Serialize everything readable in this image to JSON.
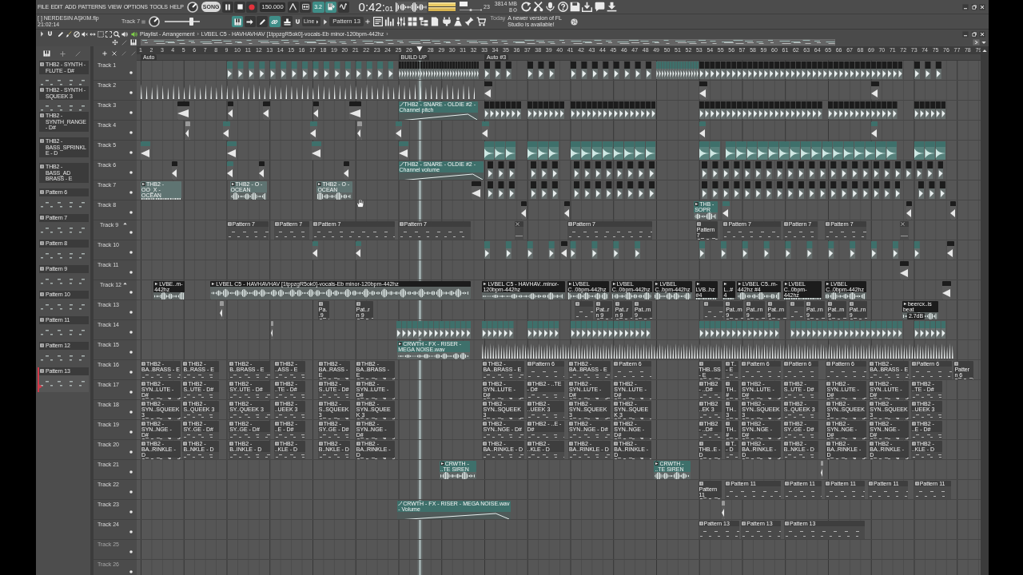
{
  "menu": [
    "FILE",
    "EDIT",
    "ADD",
    "PATTERNS",
    "VIEW",
    "OPTIONS",
    "TOOLS",
    "HELP"
  ],
  "transport": {
    "mode": "SONG",
    "playing": true,
    "tempo": "150.000",
    "toggles": [
      {
        "on": false
      },
      {
        "on": false
      },
      {
        "label": "3.2",
        "on": true
      },
      {
        "on": true
      },
      {
        "on": false
      }
    ],
    "time": "0:42:",
    "time_fraction": "01"
  },
  "meters": {
    "cpu": "23",
    "memory": "3814 MB",
    "polyphony": "8"
  },
  "hint": {
    "title": "[ ] NERDESIN AŞKIM.flp",
    "detail": "21:02:14"
  },
  "toolbar": {
    "focus": "Track 7",
    "master_slider": {
      "level": 0.75
    },
    "toggles": [
      {
        "on": true
      },
      {
        "on": false
      },
      {
        "on": false
      },
      {
        "on": true
      },
      {
        "on": false
      }
    ],
    "snap": "Line",
    "pattern": "Pattern 13"
  },
  "news": {
    "label": "Today",
    "text": "A newer version of FL Studio is available!"
  },
  "playlist": {
    "breadcrumb": [
      "Playlist - Arrangement",
      "LVBEL C5 - HAVHAVHAV [1tppzgR5ok0]-vocals-Eb minor-120bpm-442hz"
    ],
    "separator": "›",
    "ruler": [
      "1",
      "2",
      "3",
      "4",
      "5",
      "6",
      "7",
      "8",
      "9",
      "10",
      "11",
      "12",
      "13",
      "14",
      "15",
      "16",
      "17",
      "18",
      "19",
      "20",
      "21",
      "22",
      "23",
      "24",
      "25",
      "26",
      "28",
      "29",
      "30",
      "31",
      "32",
      "33",
      "34",
      "35",
      "36",
      "37",
      "38",
      "39",
      "40",
      "41",
      "42",
      "43",
      "44",
      "45",
      "46",
      "47",
      "48",
      "49",
      "50",
      "51",
      "52",
      "53",
      "54",
      "55",
      "56",
      "57",
      "58",
      "59",
      "60",
      "61",
      "62",
      "63",
      "64",
      "65",
      "66",
      "67",
      "68",
      "69",
      "70",
      "71",
      "72",
      "73",
      "74",
      "75",
      "76",
      "77",
      "78",
      "79"
    ],
    "markers": [
      "Auto",
      "BUILD UP",
      "Auto #3"
    ],
    "picker": [
      {
        "name": "THB2 - SYNTH - FLUTE - D#",
        "selected": false
      },
      {
        "name": "THB2 - SYNTH - SQUEEK 3",
        "selected": false
      },
      {
        "name": "THB2 - SYNTH_RANGE - D#",
        "selected": false
      },
      {
        "name": "THB2 - BASS_SPRINKLE - D",
        "selected": false
      },
      {
        "name": "THB2 - BASS_AD BRASS - E",
        "selected": false
      },
      {
        "name": "Pattern 6",
        "selected": false
      },
      {
        "name": "Pattern 7",
        "selected": false
      },
      {
        "name": "Pattern 8",
        "selected": false
      },
      {
        "name": "Pattern 9",
        "selected": false
      },
      {
        "name": "Pattern 10",
        "selected": false
      },
      {
        "name": "Pattern 11",
        "selected": false
      },
      {
        "name": "Pattern 12",
        "selected": false
      },
      {
        "name": "Pattern 13",
        "selected": true
      }
    ],
    "tracks": [
      {
        "name": "Track 1",
        "kind": "plain",
        "dimmed": false,
        "clips": [
          {
            "kind": "hits",
            "color": "#3e706b"
          },
          {
            "kind": "hits",
            "color": "#1c1c1c"
          },
          {
            "kind": "hits",
            "color": "#1c1c1c"
          },
          {
            "kind": "hits",
            "color": "#1c1c1c"
          },
          {
            "kind": "hits",
            "color": "#1c1c1c"
          },
          {
            "kind": "hits",
            "color": "#3e706b"
          },
          {
            "kind": "hits",
            "color": "#1c1c1c"
          },
          {
            "kind": "hits",
            "color": "#1c1c1c"
          }
        ]
      },
      {
        "name": "Track 2",
        "kind": "plain",
        "dimmed": false,
        "clips": [
          {
            "kind": "spikes"
          },
          {
            "kind": "clip",
            "color": "#1c1c1c"
          },
          {
            "kind": "clip",
            "color": "#1c1c1c"
          },
          {
            "kind": "clip",
            "color": "#1c1c1c"
          }
        ]
      },
      {
        "name": "Track 3",
        "kind": "plain",
        "dimmed": false,
        "clips": [
          {
            "kind": "clip",
            "color": "#1c1c1c"
          },
          {
            "kind": "clip",
            "color": "#1c1c1c"
          },
          {
            "kind": "clip",
            "color": "#1c1c1c"
          },
          {
            "kind": "clip",
            "color": "#1c1c1c"
          },
          {
            "kind": "clip",
            "color": "#1c1c1c"
          },
          {
            "kind": "automation",
            "label": "THB2 - SNARE - OLDIE #2 - Channel pitch",
            "color": "#3e706b"
          },
          {
            "kind": "hits",
            "color": "#1c1c1c"
          },
          {
            "kind": "hits",
            "color": "#1c1c1c"
          },
          {
            "kind": "hits",
            "color": "#1c1c1c"
          },
          {
            "kind": "hits",
            "color": "#1c1c1c"
          },
          {
            "kind": "hits",
            "color": "#1c1c1c"
          },
          {
            "kind": "hits",
            "color": "#1c1c1c"
          }
        ]
      },
      {
        "name": "Track 4",
        "kind": "plain",
        "dimmed": false,
        "clips": [
          {
            "kind": "clip",
            "color": "#9a9a9a"
          },
          {
            "kind": "clip",
            "color": "#3e706b"
          },
          {
            "kind": "clip",
            "color": "#3e706b"
          },
          {
            "kind": "clip",
            "color": "#9a9a9a"
          },
          {
            "kind": "clip",
            "color": "#3e706b"
          },
          {
            "kind": "clip",
            "color": "#3e706b"
          },
          {
            "kind": "clip",
            "color": "#3e706b"
          },
          {
            "kind": "clip",
            "color": "#3e706b"
          }
        ]
      },
      {
        "name": "Track 5",
        "kind": "plain",
        "dimmed": false,
        "clips": [
          {
            "kind": "clip",
            "color": "#3e706b"
          },
          {
            "kind": "clip",
            "color": "#3e706b"
          },
          {
            "kind": "clip",
            "color": "#3e706b"
          },
          {
            "kind": "clip",
            "color": "#3e706b"
          },
          {
            "kind": "blocks",
            "color": "#3e706b"
          },
          {
            "kind": "blocks",
            "color": "#3e706b"
          },
          {
            "kind": "blocks",
            "color": "#3e706b"
          },
          {
            "kind": "blocks",
            "color": "#3e706b"
          },
          {
            "kind": "blocks",
            "color": "#3e706b"
          },
          {
            "kind": "blocks",
            "color": "#3e706b"
          }
        ]
      },
      {
        "name": "Track 6",
        "kind": "plain",
        "dimmed": false,
        "clips": [
          {
            "kind": "clip",
            "color": "#1c1c1c"
          },
          {
            "kind": "clip",
            "color": "#3e706b"
          },
          {
            "kind": "clip",
            "color": "#1c1c1c"
          },
          {
            "kind": "clip",
            "color": "#1c1c1c"
          },
          {
            "kind": "automation",
            "label": "THB2 - SNARE - OLDIE #2 - Channel volume",
            "color": "#3e706b"
          },
          {
            "kind": "hits",
            "color": "#1c1c1c"
          },
          {
            "kind": "hits",
            "color": "#1c1c1c"
          },
          {
            "kind": "hits",
            "color": "#1c1c1c"
          },
          {
            "kind": "hits",
            "color": "#1c1c1c"
          }
        ]
      },
      {
        "name": "Track 7",
        "kind": "plain",
        "dimmed": false,
        "clips": [
          {
            "kind": "audio",
            "label": "THB2 - OO_X - OCEAN",
            "color": "#5f7472"
          },
          {
            "kind": "audio",
            "label": "THB2 - O - OCEAN",
            "color": "#5f7472"
          },
          {
            "kind": "audio",
            "label": "THB2 - O - OCEAN",
            "color": "#5f7472"
          },
          {
            "kind": "clip",
            "color": "#1c1c1c"
          },
          {
            "kind": "hits",
            "color": "#1c1c1c"
          },
          {
            "kind": "hits",
            "color": "#1c1c1c"
          },
          {
            "kind": "hits",
            "color": "#1c1c1c"
          },
          {
            "kind": "hits",
            "color": "#1c1c1c"
          },
          {
            "kind": "hits",
            "color": "#1c1c1c"
          }
        ]
      },
      {
        "name": "Track 8",
        "kind": "plain",
        "dimmed": false,
        "clips": [
          {
            "kind": "clip",
            "color": "#1c1c1c"
          },
          {
            "kind": "clip",
            "color": "#1c1c1c"
          },
          {
            "kind": "audio",
            "label": "THB - SOPR",
            "color": "#3e706b"
          },
          {
            "kind": "clip",
            "color": "#3e706b"
          },
          {
            "kind": "clip",
            "color": "#1c1c1c"
          },
          {
            "kind": "clip",
            "color": "#1c1c1c"
          }
        ]
      },
      {
        "name": "Track 9",
        "kind": "grouped",
        "dimmed": false,
        "clips": [
          {
            "kind": "pattern",
            "label": "Pattern 7"
          },
          {
            "kind": "pattern",
            "label": "Pattern 7"
          },
          {
            "kind": "pattern",
            "label": "Pattern 7"
          },
          {
            "kind": "pattern",
            "label": "Pattern 7"
          },
          {
            "kind": "empty"
          },
          {
            "kind": "pattern",
            "label": "Pattern 7"
          },
          {
            "kind": "pattern",
            "label": "Pattern 7"
          },
          {
            "kind": "pattern",
            "label": "Pattern 7"
          },
          {
            "kind": "pattern",
            "label": "Pattern 7"
          },
          {
            "kind": "pattern",
            "label": "Pattern 7"
          },
          {
            "kind": "empty"
          }
        ]
      },
      {
        "name": "Track 10",
        "kind": "plain",
        "dimmed": false,
        "clips": [
          {
            "kind": "clip",
            "color": "#3e706b"
          },
          {
            "kind": "clip",
            "color": "#3e706b"
          },
          {
            "kind": "hits",
            "color": "#3e706b"
          },
          {
            "kind": "clip",
            "color": "#1c1c1c"
          },
          {
            "kind": "hits",
            "color": "#3e706b"
          },
          {
            "kind": "clip",
            "color": "#1c1c1c"
          }
        ]
      },
      {
        "name": "Track 11",
        "kind": "plain",
        "dimmed": false,
        "clips": [
          {
            "kind": "clip",
            "color": "#1c1c1c"
          }
        ]
      },
      {
        "name": "Track 12",
        "kind": "grouped",
        "dimmed": false,
        "clips": [
          {
            "kind": "audio",
            "label": "LVBE..m-442hz",
            "color": "#1c1c1c"
          },
          {
            "kind": "audio",
            "label": "LVBEL C5 - HAVHAVHAV [1tppzgR5ok0]-vocals-Eb minor-120bpm-442hz",
            "color": "#1c1c1c"
          },
          {
            "kind": "audio",
            "label": "LVBEL C5 - HAVHAV..minor-120bpm-442hz",
            "color": "#1c1c1c"
          },
          {
            "kind": "audio",
            "label": "LVBEL C..0bpm-442hz",
            "color": "#1c1c1c"
          },
          {
            "kind": "audio",
            "label": "LVBEL C..0bpm-442hz",
            "color": "#1c1c1c"
          },
          {
            "kind": "audio",
            "label": "LVBEL C..bpm-442hz",
            "color": "#1c1c1c"
          },
          {
            "kind": "audio",
            "label": "LVB..hz #4",
            "color": "#1c1c1c"
          },
          {
            "kind": "audio",
            "label": "L..#4",
            "color": "#1c1c1c"
          },
          {
            "kind": "audio",
            "label": "LVBEL C5..m-442hz #4",
            "color": "#1c1c1c"
          },
          {
            "kind": "audio",
            "label": "LVBEL C..0bpm-442hz",
            "color": "#1c1c1c"
          },
          {
            "kind": "audio",
            "label": "LVBEL C..0bpm-442hz",
            "color": "#1c1c1c"
          },
          {
            "kind": "clip",
            "color": "#1c1c1c"
          }
        ]
      },
      {
        "name": "Track 13",
        "kind": "plain",
        "dimmed": false,
        "clips": [
          {
            "kind": "clip",
            "color": "#9a9a9a"
          },
          {
            "kind": "pattern",
            "label": "Pa..9"
          },
          {
            "kind": "pattern",
            "label": "Pat..rn 9"
          },
          {
            "kind": "pattern"
          },
          {
            "kind": "pattern",
            "label": "Pat..rn 9"
          },
          {
            "kind": "pattern",
            "label": "Pat..rn 9"
          },
          {
            "kind": "pattern",
            "label": "Pat..rn 9"
          },
          {
            "kind": "pattern"
          },
          {
            "kind": "pattern",
            "label": "Pat..rn 9"
          },
          {
            "kind": "pattern",
            "label": "Pat..rn 9"
          },
          {
            "kind": "pattern",
            "label": "Pat..rn 9"
          },
          {
            "kind": "pattern"
          },
          {
            "kind": "pattern",
            "label": "Pat..rn 9"
          },
          {
            "kind": "pattern",
            "label": "Pat..rn 9"
          },
          {
            "kind": "pattern",
            "label": "Pat..rn 9"
          },
          {
            "kind": "audio",
            "label": "beercx..is beat",
            "color": "#1c1c1c",
            "tooltip": "2.7dB"
          }
        ]
      },
      {
        "name": "Track 14",
        "kind": "plain",
        "dimmed": false,
        "clips": [
          {
            "kind": "clip",
            "color": "#9a9a9a"
          },
          {
            "kind": "hits",
            "color": "#3e706b"
          },
          {
            "kind": "hits",
            "color": "#3e706b"
          },
          {
            "kind": "hits",
            "color": "#3e706b"
          },
          {
            "kind": "hits",
            "color": "#3e706b"
          },
          {
            "kind": "hits",
            "color": "#3e706b"
          },
          {
            "kind": "hits",
            "color": "#3e706b"
          },
          {
            "kind": "hits",
            "color": "#3e706b"
          }
        ]
      },
      {
        "name": "Track 15",
        "kind": "plain",
        "dimmed": false,
        "clips": [
          {
            "kind": "audio",
            "label": "CRWTH - FX - RISER - MEGA NOISE.wav",
            "color": "#3e706b"
          },
          {
            "kind": "spikes"
          }
        ]
      },
      {
        "name": "Track 16",
        "kind": "plain",
        "dimmed": false,
        "clips": [
          {
            "kind": "pattern",
            "label": "THB2 - BA..BRASS - E"
          },
          {
            "kind": "pattern",
            "label": "THB2 - B..RASS - E"
          },
          {
            "kind": "pattern",
            "label": "THB2 - B..BRASS - E"
          },
          {
            "kind": "pattern",
            "label": "THB2 - ..ASS - E"
          },
          {
            "kind": "pattern",
            "label": "THB2 - BA..RASS - E"
          },
          {
            "kind": "pattern",
            "label": "THB2 - BA..BRASS - E"
          },
          {
            "kind": "pattern",
            "label": "THB2 - BA..BRASS - E"
          },
          {
            "kind": "pattern",
            "label": "Pattern 6"
          },
          {
            "kind": "pattern",
            "label": "THB2 - BA..BRASS - E"
          },
          {
            "kind": "pattern",
            "label": "Pattern 6"
          },
          {
            "kind": "pattern",
            "label": "THB..SS - E"
          },
          {
            "kind": "pattern",
            "label": "T.. - E"
          },
          {
            "kind": "pattern",
            "label": "Pattern 6"
          },
          {
            "kind": "pattern",
            "label": "Pattern 6"
          },
          {
            "kind": "pattern",
            "label": "Pattern 6"
          },
          {
            "kind": "pattern",
            "label": "THB2 - BA..BRASS - E"
          },
          {
            "kind": "pattern",
            "label": "Pattern 6"
          },
          {
            "kind": "pattern",
            "label": "Pattern 6"
          }
        ]
      },
      {
        "name": "Track 17",
        "kind": "plain",
        "dimmed": false,
        "clips": [
          {
            "kind": "pattern",
            "label": "THB2 - SYN..LUTE - D#"
          },
          {
            "kind": "pattern",
            "label": "THB2 - S..UTE - D#"
          },
          {
            "kind": "pattern",
            "label": "THB2 - SY..UTE - D#"
          },
          {
            "kind": "pattern",
            "label": "THB2 - ..TE - D#"
          },
          {
            "kind": "pattern",
            "label": "THB2 - S..UTE - D#"
          },
          {
            "kind": "pattern",
            "label": "THB2 - SYN..LUTE - D#"
          },
          {
            "kind": "pattern",
            "label": "THB2 - SYN..LUTE - D#"
          },
          {
            "kind": "pattern",
            "label": "THB2 - ..TE - D#"
          },
          {
            "kind": "pattern",
            "label": "THB2 - SYN..LUTE - D#"
          },
          {
            "kind": "pattern",
            "label": "THB2 - SYN..LUTE - D#"
          },
          {
            "kind": "pattern",
            "label": "THB2 - ..D#"
          },
          {
            "kind": "pattern",
            "label": "TH..#"
          },
          {
            "kind": "pattern",
            "label": "THB2 - SYN..LUTE - D#"
          },
          {
            "kind": "pattern",
            "label": "THB2 - S..UTE - D#"
          },
          {
            "kind": "pattern",
            "label": "THB2 - SYN..LUTE - D#"
          },
          {
            "kind": "pattern",
            "label": "THB2 - SYN..LUTE - D#"
          },
          {
            "kind": "pattern",
            "label": "THB2 - ..TE - D#"
          }
        ]
      },
      {
        "name": "Track 18",
        "kind": "plain",
        "dimmed": false,
        "clips": [
          {
            "kind": "pattern",
            "label": "THB2 - SYN..SQUEEK 3"
          },
          {
            "kind": "pattern",
            "label": "THB2 - S..QUEEK 3"
          },
          {
            "kind": "pattern",
            "label": "THB2 - SY..QUEEK 3"
          },
          {
            "kind": "pattern",
            "label": "THB2 - ..UEEK 3"
          },
          {
            "kind": "pattern",
            "label": "THB2 - S..SQUEEK 3"
          },
          {
            "kind": "pattern",
            "label": "THB2 - SYN..SQUEEK 3"
          },
          {
            "kind": "pattern",
            "label": "THB2 - SYN..SQUEEK 3"
          },
          {
            "kind": "pattern",
            "label": "THB2 - ..UEEK 3"
          },
          {
            "kind": "pattern",
            "label": "THB2 - SYN..SQUEEK 3"
          },
          {
            "kind": "pattern",
            "label": "THB2 - SYN..SQUEEK 3"
          },
          {
            "kind": "pattern",
            "label": "THB2 ..EK 3"
          },
          {
            "kind": "pattern",
            "label": "TH..3"
          },
          {
            "kind": "pattern",
            "label": "THB2 - SYN..SQUEEK 3"
          },
          {
            "kind": "pattern",
            "label": "THB2 - S..QUEEK 3"
          },
          {
            "kind": "pattern",
            "label": "THB2 - SYN..SQUEEK 3"
          },
          {
            "kind": "pattern",
            "label": "THB2 - SYN..SQUEEK 3"
          },
          {
            "kind": "pattern",
            "label": "THB2 - ..UEEK 3"
          }
        ]
      },
      {
        "name": "Track 19",
        "kind": "plain",
        "dimmed": false,
        "clips": [
          {
            "kind": "pattern",
            "label": "THB2 - SYN..NGE - D#"
          },
          {
            "kind": "pattern",
            "label": "THB2 - SY..GE - D#"
          },
          {
            "kind": "pattern",
            "label": "THB2 - SY..GE - D#"
          },
          {
            "kind": "pattern",
            "label": "THB2 - ..E - D#"
          },
          {
            "kind": "pattern",
            "label": "THB2 - SY..GE - D#"
          },
          {
            "kind": "pattern",
            "label": "THB2 - SYN..NGE - D#"
          },
          {
            "kind": "pattern",
            "label": "THB2 - SYN..NGE - D#"
          },
          {
            "kind": "pattern",
            "label": "THB2 - ..E - D#"
          },
          {
            "kind": "pattern",
            "label": "THB2 - SYN..NGE - D#"
          },
          {
            "kind": "pattern",
            "label": "THB2 - SYN..NGE - D#"
          },
          {
            "kind": "pattern",
            "label": "THB2 - ..D#"
          },
          {
            "kind": "pattern",
            "label": "TH..#"
          },
          {
            "kind": "pattern",
            "label": "THB2 - SYN..NGE - D#"
          },
          {
            "kind": "pattern",
            "label": "THB2 - SY..GE - D#"
          },
          {
            "kind": "pattern",
            "label": "THB2 - SYN..NGE - D#"
          },
          {
            "kind": "pattern",
            "label": "THB2 - SYN..NGE - D#"
          },
          {
            "kind": "pattern",
            "label": "THB2 - ..E - D#"
          }
        ]
      },
      {
        "name": "Track 20",
        "kind": "plain",
        "dimmed": false,
        "clips": [
          {
            "kind": "pattern",
            "label": "THB2 - BA..RINKLE - D"
          },
          {
            "kind": "pattern",
            "label": "THB2 - B..NKLE - D"
          },
          {
            "kind": "pattern",
            "label": "THB2 - B..INKLE - D"
          },
          {
            "kind": "pattern",
            "label": "THB2 - ..KLE - D"
          },
          {
            "kind": "pattern",
            "label": "THB2 - B..NKLE - D"
          },
          {
            "kind": "pattern",
            "label": "THB2 - BA..RINKLE - D"
          },
          {
            "kind": "pattern",
            "label": "THB2 - BA..RINKLE - D"
          },
          {
            "kind": "pattern",
            "label": "THB2 - ..KLE - D"
          },
          {
            "kind": "pattern",
            "label": "THB2 - BA..RINKLE - D"
          },
          {
            "kind": "pattern",
            "label": "THB2 - BA..RINKLE - D"
          },
          {
            "kind": "pattern",
            "label": "THB..E - D"
          },
          {
            "kind": "pattern",
            "label": "T.. - D"
          },
          {
            "kind": "pattern",
            "label": "THB2 - BA..RINKLE - D"
          },
          {
            "kind": "pattern",
            "label": "THB2 - B..NKLE - D"
          },
          {
            "kind": "pattern",
            "label": "THB2 - BA..RINKLE - D"
          },
          {
            "kind": "pattern",
            "label": "THB2 - BA..RINKLE - D"
          },
          {
            "kind": "pattern",
            "label": "THB2 - ..KLE - D"
          }
        ]
      },
      {
        "name": "Track 21",
        "kind": "plain",
        "dimmed": false,
        "clips": [
          {
            "kind": "audio",
            "label": "CRWTH - ..TE SIREN",
            "color": "#3e706b"
          },
          {
            "kind": "audio",
            "label": "CRWTH - ..TE SIREN",
            "color": "#3e706b"
          },
          {
            "kind": "clip",
            "color": "#9a9a9a"
          }
        ]
      },
      {
        "name": "Track 22",
        "kind": "plain",
        "dimmed": false,
        "clips": [
          {
            "kind": "pattern",
            "label": "Pattern 11"
          },
          {
            "kind": "pattern",
            "label": "Pattern 11"
          },
          {
            "kind": "pattern",
            "label": "Pattern 11"
          },
          {
            "kind": "pattern",
            "label": "Pattern 11"
          },
          {
            "kind": "pattern",
            "label": "Pattern 11"
          },
          {
            "kind": "pattern",
            "label": "Pattern 11"
          }
        ]
      },
      {
        "name": "Track 23",
        "kind": "plain",
        "dimmed": false,
        "clips": [
          {
            "kind": "automation",
            "label": "CRWTH - FX - RISER - MEGA NOISE.wav - Volume",
            "color": "#3e706b"
          },
          {
            "kind": "clip",
            "color": "#9a9a9a"
          }
        ]
      },
      {
        "name": "Track 24",
        "kind": "plain",
        "dimmed": false,
        "clips": [
          {
            "kind": "pattern",
            "label": "Pattern 13"
          },
          {
            "kind": "pattern",
            "label": "Pattern 13"
          },
          {
            "kind": "pattern",
            "label": "Pattern 13"
          }
        ]
      },
      {
        "name": "Track 25",
        "kind": "plain",
        "dimmed": true
      },
      {
        "name": "Track 26",
        "kind": "plain",
        "dimmed": true
      }
    ]
  }
}
